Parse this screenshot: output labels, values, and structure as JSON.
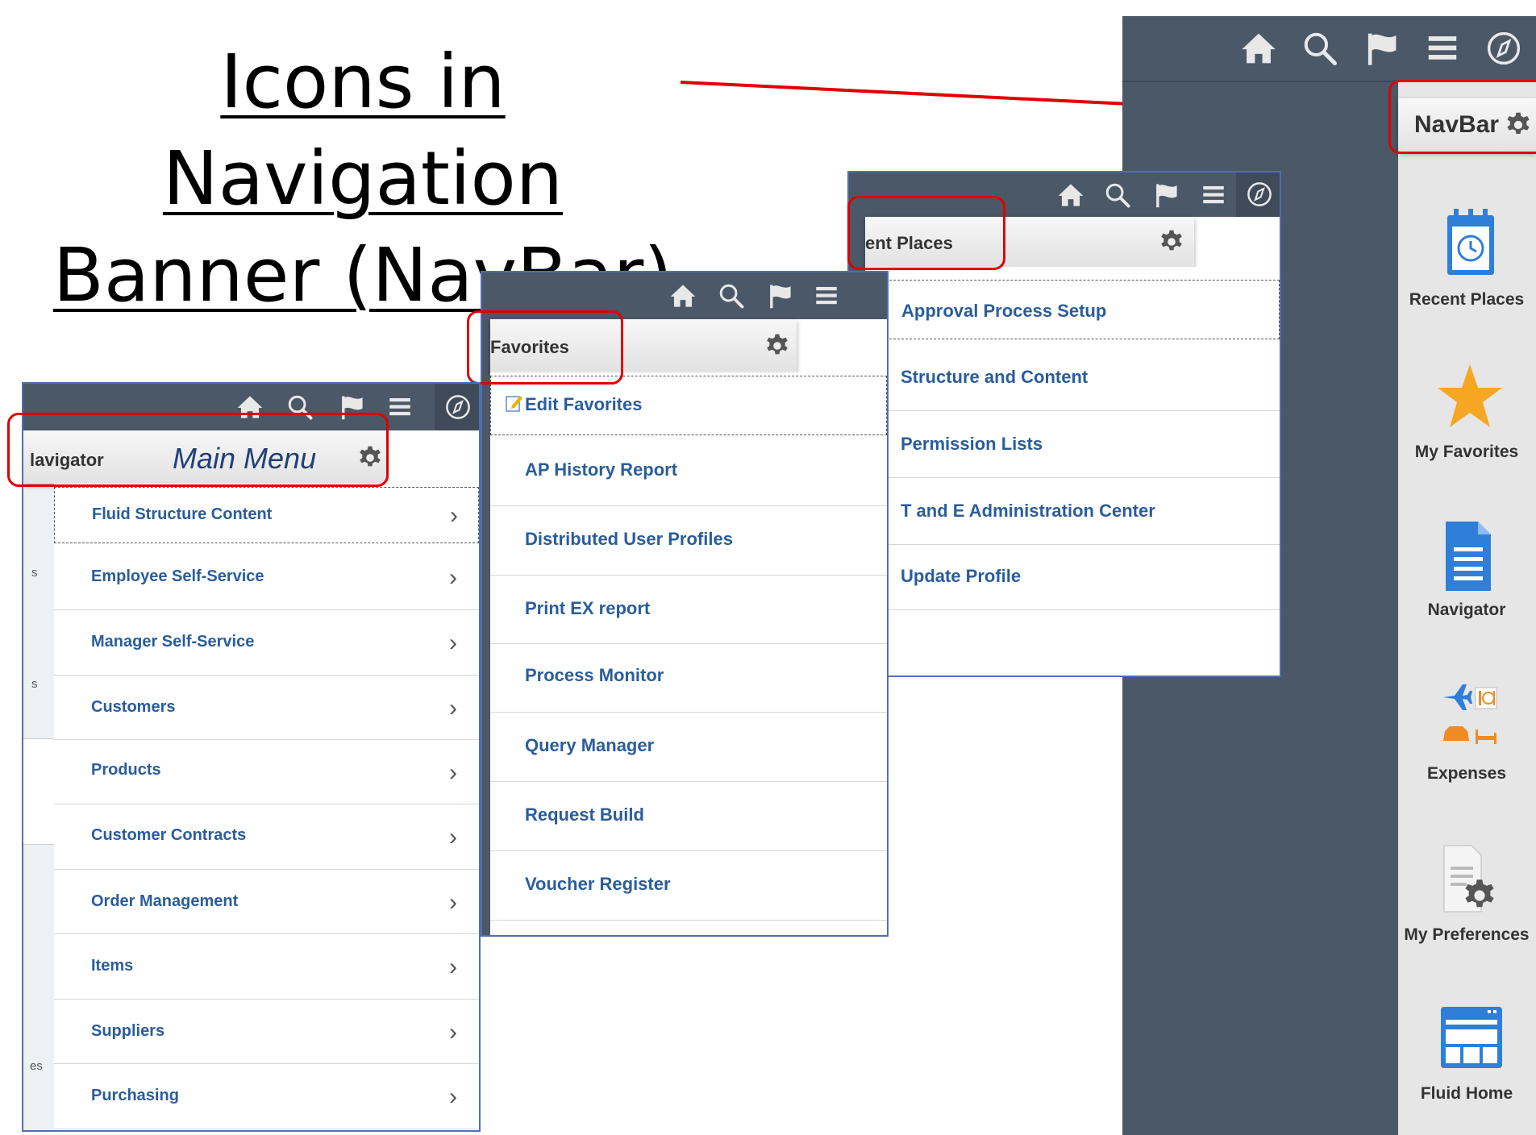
{
  "title": {
    "line1": "Icons in Navigation",
    "line2": "Banner (NavBar)"
  },
  "navbar": {
    "header": "NavBar",
    "tiles": [
      {
        "label": "Recent Places",
        "icon": "calendar-clock-icon"
      },
      {
        "label": "My Favorites",
        "icon": "star-icon"
      },
      {
        "label": "Navigator",
        "icon": "document-icon"
      },
      {
        "label": "Expenses",
        "icon": "expenses-icon"
      },
      {
        "label": "My Preferences",
        "icon": "preferences-icon"
      },
      {
        "label": "Fluid Home",
        "icon": "fluid-home-icon"
      }
    ]
  },
  "recent_places": {
    "header": "ent Places",
    "items": [
      "Approval Process Setup",
      "Structure and Content",
      "Permission Lists",
      "T and E Administration Center",
      "Update Profile"
    ]
  },
  "favorites": {
    "header": "Favorites",
    "edit_label": "Edit Favorites",
    "items": [
      "AP History Report",
      "Distributed User Profiles",
      "Print EX report",
      "Process Monitor",
      "Query Manager",
      "Request Build",
      "Voucher Register"
    ]
  },
  "navigator": {
    "header": "lavigator",
    "caption": "Main Menu",
    "side_fragments": [
      "s",
      "s",
      "es"
    ],
    "items": [
      "Fluid Structure Content",
      "Employee Self-Service",
      "Manager Self-Service",
      "Customers",
      "Products",
      "Customer Contracts",
      "Order Management",
      "Items",
      "Suppliers",
      "Purchasing"
    ],
    "chevron": "›"
  },
  "colors": {
    "banner": "#4a5868",
    "link": "#2a5d9b",
    "highlight": "#e00000",
    "star": "#f5a623",
    "tile_blue": "#2f7fd8"
  }
}
